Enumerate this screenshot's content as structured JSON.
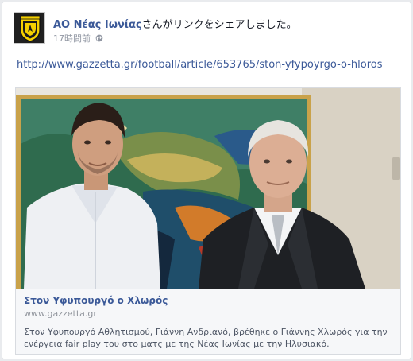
{
  "post": {
    "author": "ΑΟ Νέας Ιωνίας",
    "action": "さんがリンクをシェアしました。",
    "timestamp": "17時間前",
    "privacy_icon": "globe-icon",
    "link_url": "http://www.gazzetta.gr/football/article/653765/ston-yfypoyrgo-o-hloros"
  },
  "attachment": {
    "title": "Στον Υφυπουργό ο Χλωρός",
    "domain": "www.gazzetta.gr",
    "description": "Στον Υφυπουργό Αθλητισμού, Γιάννη Ανδριανό, βρέθηκε ο Γιάννης Χλωρός για την ενέργεια fair play του στο ματς με της Νέας Ιωνίας με την Ηλυσιακό."
  },
  "colors": {
    "link": "#3b5998",
    "meta": "#9197a3",
    "avatar_yellow": "#f5d000"
  }
}
